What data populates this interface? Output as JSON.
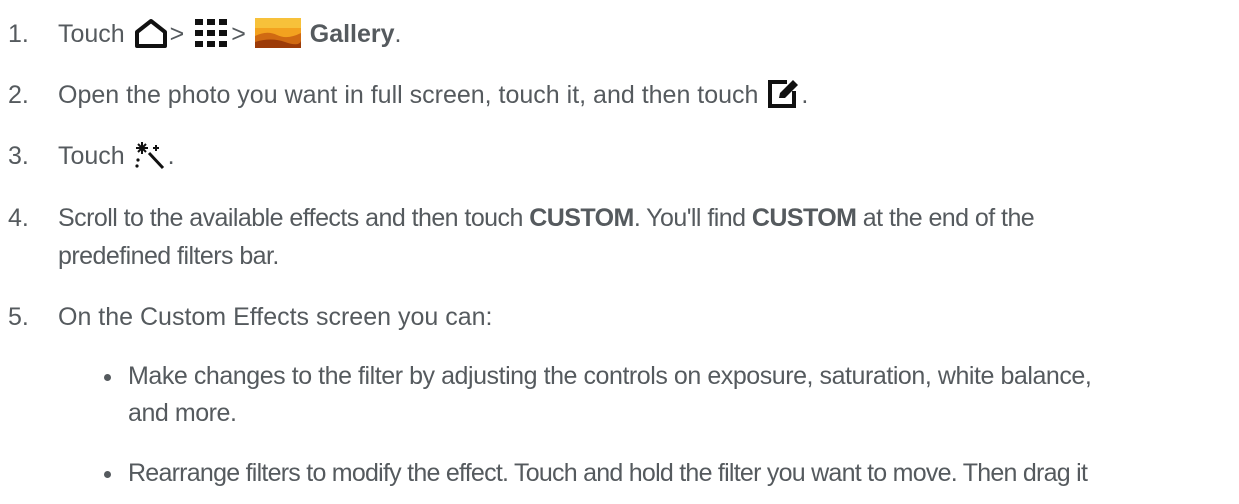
{
  "steps": [
    {
      "num": "1.",
      "parts": {
        "touch": "Touch",
        "sep1": ">",
        "sep2": ">",
        "gallery": "Gallery",
        "end": "."
      },
      "icons": [
        "home-icon",
        "apps-grid-icon",
        "gallery-app-icon"
      ]
    },
    {
      "num": "2.",
      "text": "Open the photo you want in full screen, touch it, and then touch",
      "end": ".",
      "icons": [
        "edit-icon"
      ]
    },
    {
      "num": "3.",
      "text": "Touch",
      "end": ".",
      "icons": [
        "magic-wand-icon"
      ]
    },
    {
      "num": "4.",
      "pre": "Scroll to the available effects and then touch ",
      "b1": "CUSTOM",
      "mid": ". You'll find ",
      "b2": "CUSTOM",
      "post": " at the end of the",
      "line2": "predefined filters bar."
    },
    {
      "num": "5.",
      "text": "On the Custom Effects screen you can:"
    }
  ],
  "bullets": [
    {
      "line1": "Make changes to the filter by adjusting the controls on exposure, saturation, white balance,",
      "line2": "and more."
    },
    {
      "line1": "Rearrange filters to modify the effect. Touch and hold the filter you want to move. Then drag it"
    }
  ],
  "colors": {
    "text": "#555a5e",
    "icon": "#111111"
  }
}
